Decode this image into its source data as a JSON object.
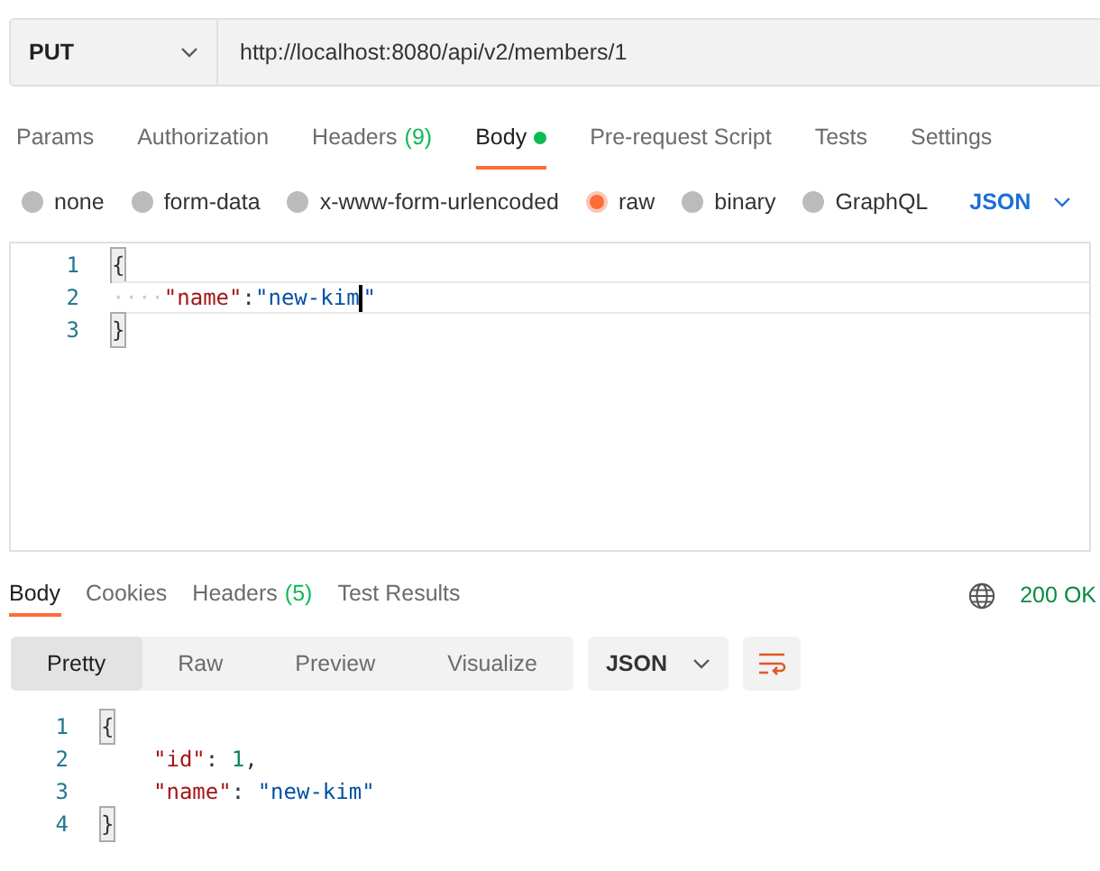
{
  "request": {
    "method": "PUT",
    "url": "http://localhost:8080/api/v2/members/1"
  },
  "request_tabs": [
    {
      "label": "Params",
      "selected": false
    },
    {
      "label": "Authorization",
      "selected": false
    },
    {
      "label": "Headers",
      "count": "(9)",
      "selected": false
    },
    {
      "label": "Body",
      "selected": true,
      "has_content": true
    },
    {
      "label": "Pre-request Script",
      "selected": false
    },
    {
      "label": "Tests",
      "selected": false
    },
    {
      "label": "Settings",
      "selected": false
    }
  ],
  "body_types": [
    {
      "label": "none",
      "selected": false
    },
    {
      "label": "form-data",
      "selected": false
    },
    {
      "label": "x-www-form-urlencoded",
      "selected": false
    },
    {
      "label": "raw",
      "selected": true
    },
    {
      "label": "binary",
      "selected": false
    },
    {
      "label": "GraphQL",
      "selected": false
    }
  ],
  "body_format": "JSON",
  "request_body": [
    {
      "number": "1",
      "tokens": [
        {
          "kind": "brace",
          "text": "{"
        }
      ]
    },
    {
      "number": "2",
      "current": true,
      "tokens": [
        {
          "kind": "indent",
          "text": "····"
        },
        {
          "kind": "key",
          "text": "\"name\""
        },
        {
          "kind": "punct",
          "text": ":"
        },
        {
          "kind": "string",
          "text": "\"new-kim"
        },
        {
          "kind": "cursor"
        },
        {
          "kind": "string",
          "text": "\""
        }
      ]
    },
    {
      "number": "3",
      "tokens": [
        {
          "kind": "brace",
          "text": "}"
        }
      ]
    }
  ],
  "response_tabs": [
    {
      "label": "Body",
      "selected": true
    },
    {
      "label": "Cookies",
      "selected": false
    },
    {
      "label": "Headers",
      "count": "(5)",
      "selected": false
    },
    {
      "label": "Test Results",
      "selected": false
    }
  ],
  "status": "200 OK",
  "view_modes": [
    {
      "label": "Pretty",
      "selected": true
    },
    {
      "label": "Raw",
      "selected": false
    },
    {
      "label": "Preview",
      "selected": false
    },
    {
      "label": "Visualize",
      "selected": false
    }
  ],
  "response_format": "JSON",
  "response_body": [
    {
      "number": "1",
      "tokens": [
        {
          "kind": "brace",
          "text": "{"
        }
      ]
    },
    {
      "number": "2",
      "indented": true,
      "tokens": [
        {
          "kind": "key",
          "text": "\"id\""
        },
        {
          "kind": "punct",
          "text": ": "
        },
        {
          "kind": "number",
          "text": "1"
        },
        {
          "kind": "punct",
          "text": ","
        }
      ]
    },
    {
      "number": "3",
      "indented": true,
      "tokens": [
        {
          "kind": "key",
          "text": "\"name\""
        },
        {
          "kind": "punct",
          "text": ": "
        },
        {
          "kind": "string",
          "text": "\"new-kim\""
        }
      ]
    },
    {
      "number": "4",
      "tokens": [
        {
          "kind": "brace",
          "text": "}"
        }
      ]
    }
  ]
}
